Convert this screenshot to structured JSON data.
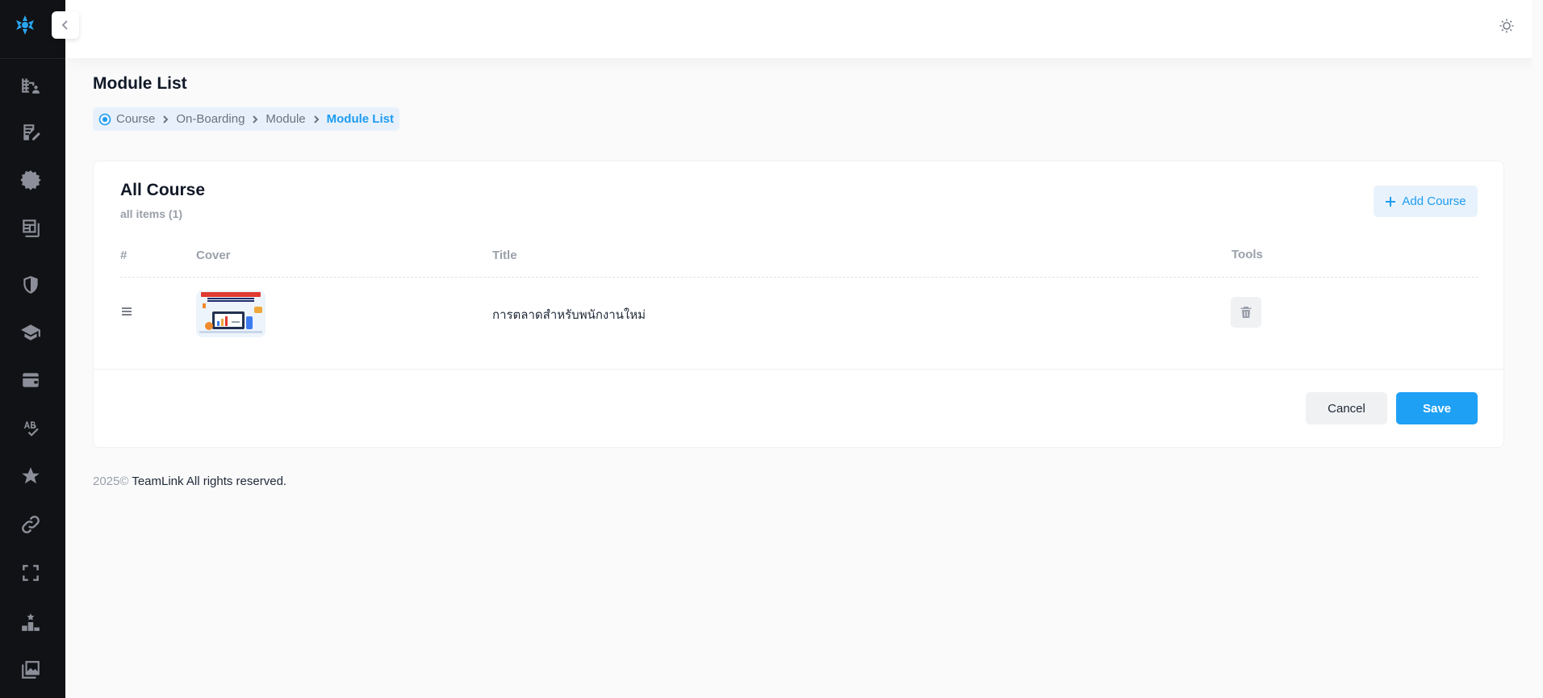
{
  "sidebar": {
    "logo": "teamlink-logo",
    "items": [
      {
        "icon": "building-users-icon"
      },
      {
        "icon": "edit-document-icon"
      },
      {
        "icon": "badge-icon"
      },
      {
        "icon": "news-icon"
      },
      {
        "icon": "shield-icon"
      },
      {
        "icon": "graduation-cap-icon"
      },
      {
        "icon": "wallet-icon"
      },
      {
        "icon": "spellcheck-icon"
      },
      {
        "icon": "star-icon"
      },
      {
        "icon": "link-icon"
      },
      {
        "icon": "fullscreen-icon"
      },
      {
        "icon": "podium-icon"
      },
      {
        "icon": "photo-library-icon"
      }
    ]
  },
  "header": {
    "theme_icon": "sun-icon"
  },
  "page": {
    "title": "Module List",
    "breadcrumb": [
      "Course",
      "On-Boarding",
      "Module",
      "Module List"
    ]
  },
  "card": {
    "title": "All Course",
    "subtitle": "all items (1)",
    "add_button": "Add Course",
    "columns": [
      "#",
      "Cover",
      "Title",
      "Tools"
    ],
    "rows": [
      {
        "title": "การตลาดสำหรับพนักงานใหม่"
      }
    ],
    "cancel_label": "Cancel",
    "save_label": "Save"
  },
  "footer": {
    "year": "2025©",
    "text": "TeamLink All rights reserved."
  },
  "colors": {
    "sidebar_bg": "#111215",
    "accent": "#1ea0f5",
    "breadcrumb_bg": "#e8f1fb"
  }
}
